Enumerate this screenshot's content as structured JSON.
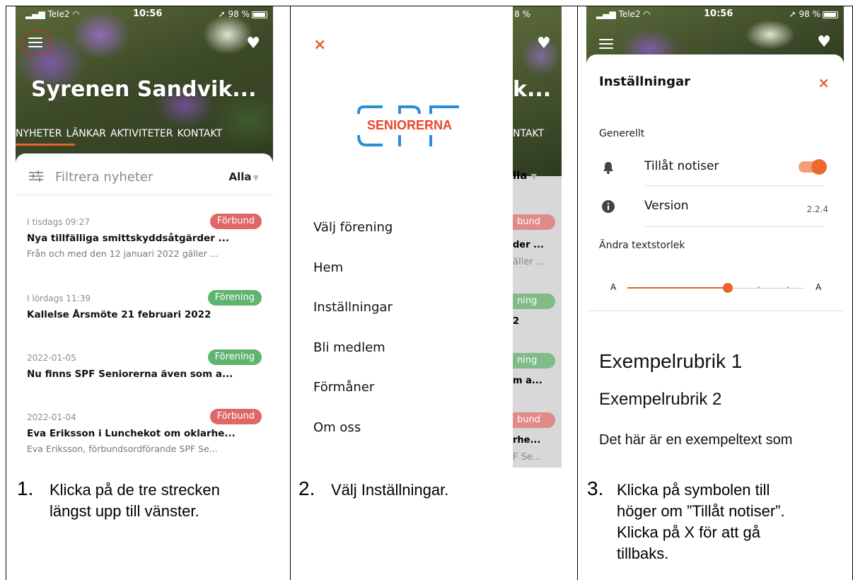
{
  "panel1": {
    "status": {
      "carrier": "Tele2",
      "time": "10:56",
      "battery": "98 %"
    },
    "hero_title": "Syrenen Sandvik...",
    "tabs": [
      "NYHETER",
      "LÄNKAR",
      "AKTIVITETER",
      "KONTAKT"
    ],
    "filter": {
      "placeholder": "Filtrera nyheter",
      "selected": "Alla"
    },
    "news": [
      {
        "date": "I tisdags 09:27",
        "badge": "Förbund",
        "title": "Nya tillfälliga smittskyddsåtgärder ...",
        "snippet": "Från och med den 12 januari 2022 gäller ..."
      },
      {
        "date": "I lördags 11:39",
        "badge": "Förening",
        "title": "Kallelse Årsmöte 21 februari 2022",
        "snippet": ""
      },
      {
        "date": "2022-01-05",
        "badge": "Förening",
        "title": "Nu finns SPF Seniorerna även som a...",
        "snippet": ""
      },
      {
        "date": "2022-01-04",
        "badge": "Förbund",
        "title": "Eva Eriksson i Lunchekot om oklarhe...",
        "snippet": "Eva Eriksson, förbundsordförande SPF Se..."
      }
    ],
    "caption_num": "1.",
    "caption_lines": [
      "Klicka på de tre strecken",
      "längst upp till vänster."
    ]
  },
  "panel2": {
    "close": "×",
    "logo_text": "SENIORERNA",
    "menu": [
      "Välj förening",
      "Hem",
      "Inställningar",
      "Bli medlem",
      "Förmåner",
      "Om oss"
    ],
    "behind": {
      "battery": "8 %",
      "title": "k...",
      "tab": "NTAKT",
      "filter": "lla",
      "badges": [
        "bund",
        "ning",
        "ning",
        "bund"
      ],
      "titles": [
        "der ...",
        "2",
        "m a...",
        "rhe..."
      ],
      "snippets": [
        "äller ...",
        "F Se..."
      ]
    },
    "caption_num": "2.",
    "caption_lines": [
      "Välj Inställningar."
    ]
  },
  "panel3": {
    "status": {
      "carrier": "Tele2",
      "time": "10:56",
      "battery": "98 %"
    },
    "title": "Inställningar",
    "close": "×",
    "general_label": "Generellt",
    "notify_label": "Tillåt notiser",
    "version_label": "Version",
    "version_value": "2.2.4",
    "textsize_label": "Ändra textstorlek",
    "slider_min": "A",
    "slider_max": "A",
    "example_h1": "Exempelrubrik 1",
    "example_h2": "Exempelrubrik 2",
    "example_p": "Det här är en exempeltext som",
    "caption_num": "3.",
    "caption_lines": [
      "Klicka på symbolen till",
      "höger om ”Tillåt notiser”.",
      "Klicka på X för att gå",
      "tillbaks."
    ]
  }
}
